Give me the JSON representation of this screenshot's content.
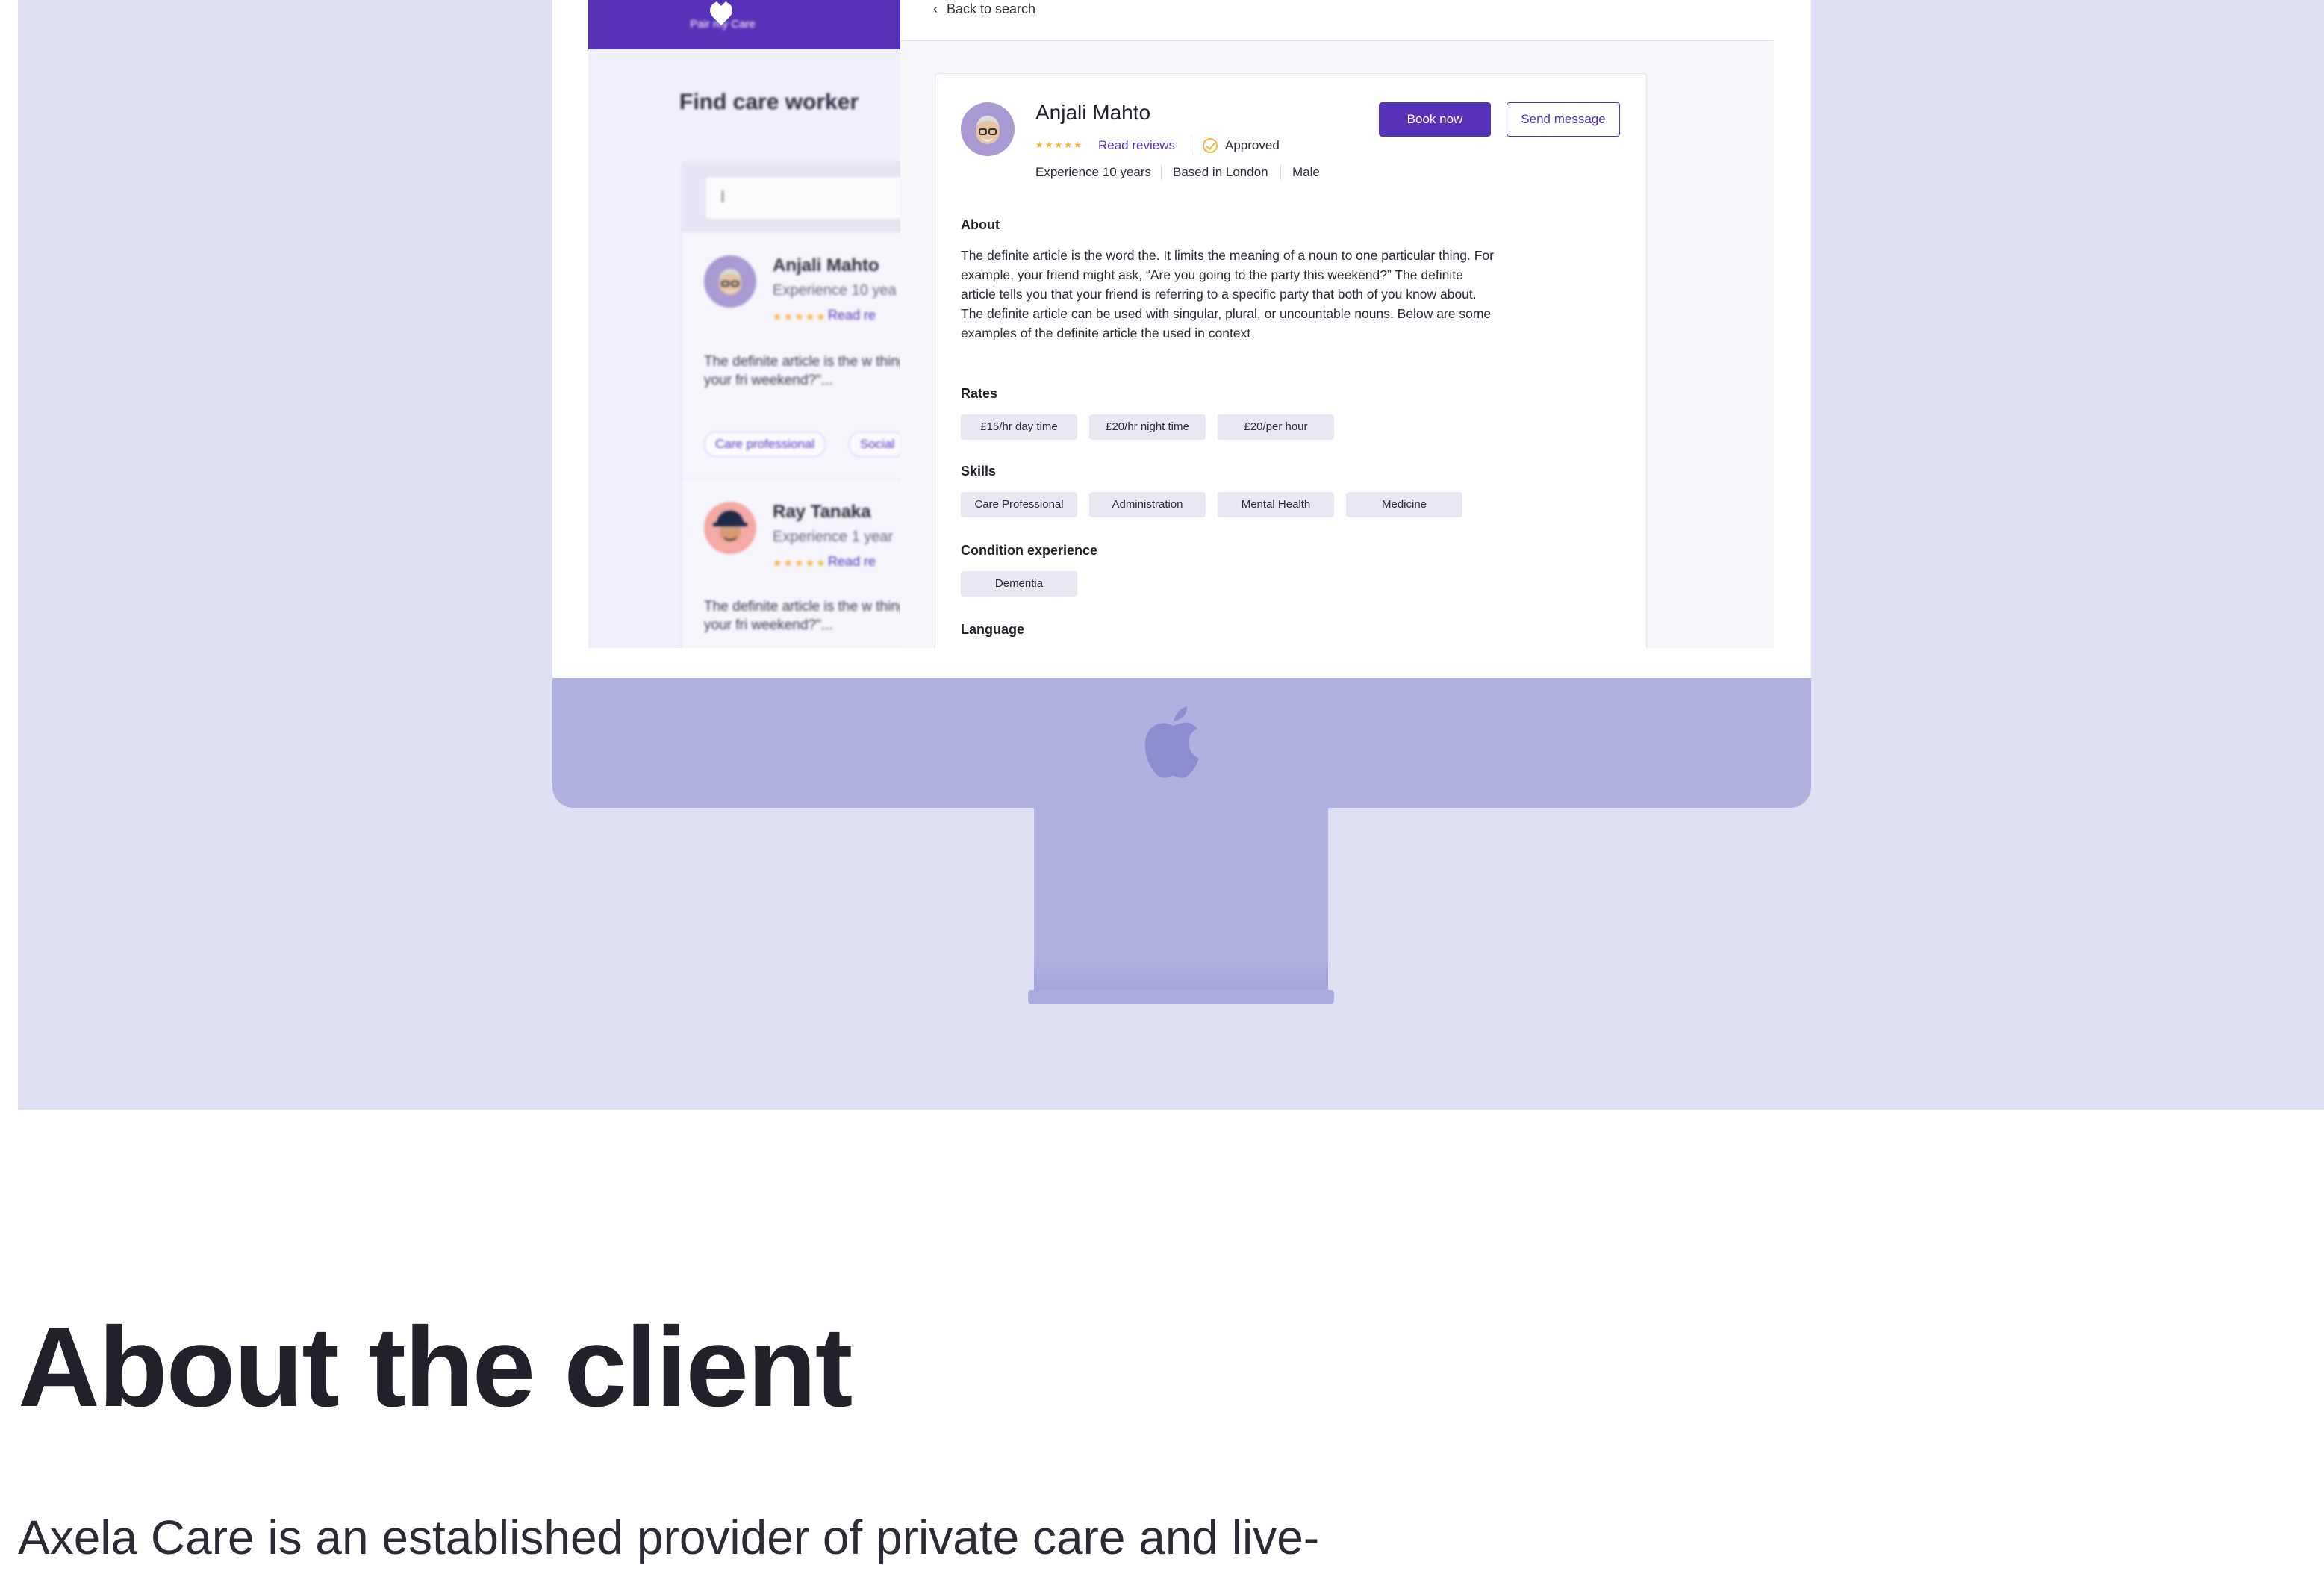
{
  "app": {
    "brand_name": "Pair my Care",
    "find_title": "Find care worker",
    "search": {
      "value": "I"
    },
    "back_link": "Back to search",
    "list": [
      {
        "name": "Anjali Mahto",
        "experience": "Experience 10 yea",
        "stars": "★★★★★",
        "read": "Read re",
        "snippet": "The definite article is the w thing. For example, your fri weekend?\"...",
        "tags": [
          "Care professional",
          "Social"
        ]
      },
      {
        "name": "Ray Tanaka",
        "experience": "Experience 1 year",
        "stars": "★★★★★",
        "read": "Read re",
        "snippet": "The definite article is the w thing. For example, your fri weekend?\"...",
        "tags": []
      }
    ],
    "profile": {
      "name": "Anjali Mahto",
      "stars": "★★★★★",
      "read_reviews": "Read reviews",
      "approved": "Approved",
      "experience": "Experience 10 years",
      "location": "Based in London",
      "gender": "Male",
      "book_now": "Book now",
      "send_message": "Send message",
      "about_title": "About",
      "about_text": "The definite article is the word the. It limits the meaning of a noun to one particular thing. For example, your friend might ask, “Are you going to the party this weekend?” The definite article tells you that your friend is referring to a specific party that both of you know about. The definite article can be used with singular, plural, or uncountable nouns. Below are some examples of the definite article the used in context",
      "rates_title": "Rates",
      "rates": [
        "£15/hr day time",
        "£20/hr night time",
        "£20/per hour"
      ],
      "skills_title": "Skills",
      "skills": [
        "Care Professional",
        "Administration",
        "Mental Health",
        "Medicine"
      ],
      "condition_title": "Condition experience",
      "conditions": [
        "Dementia"
      ],
      "language_title": "Language"
    }
  },
  "section": {
    "heading": "About the client",
    "body": "Axela Care is an established provider of private care and live-"
  },
  "colors": {
    "brand": "#5532b8",
    "hero_bg": "#e0e0f5",
    "monitor": "#b0b1e0",
    "star": "#f3b33d"
  },
  "icons": [
    "apple-logo-icon",
    "chevron-left-icon",
    "approved-check-icon",
    "brand-heart-icon"
  ]
}
